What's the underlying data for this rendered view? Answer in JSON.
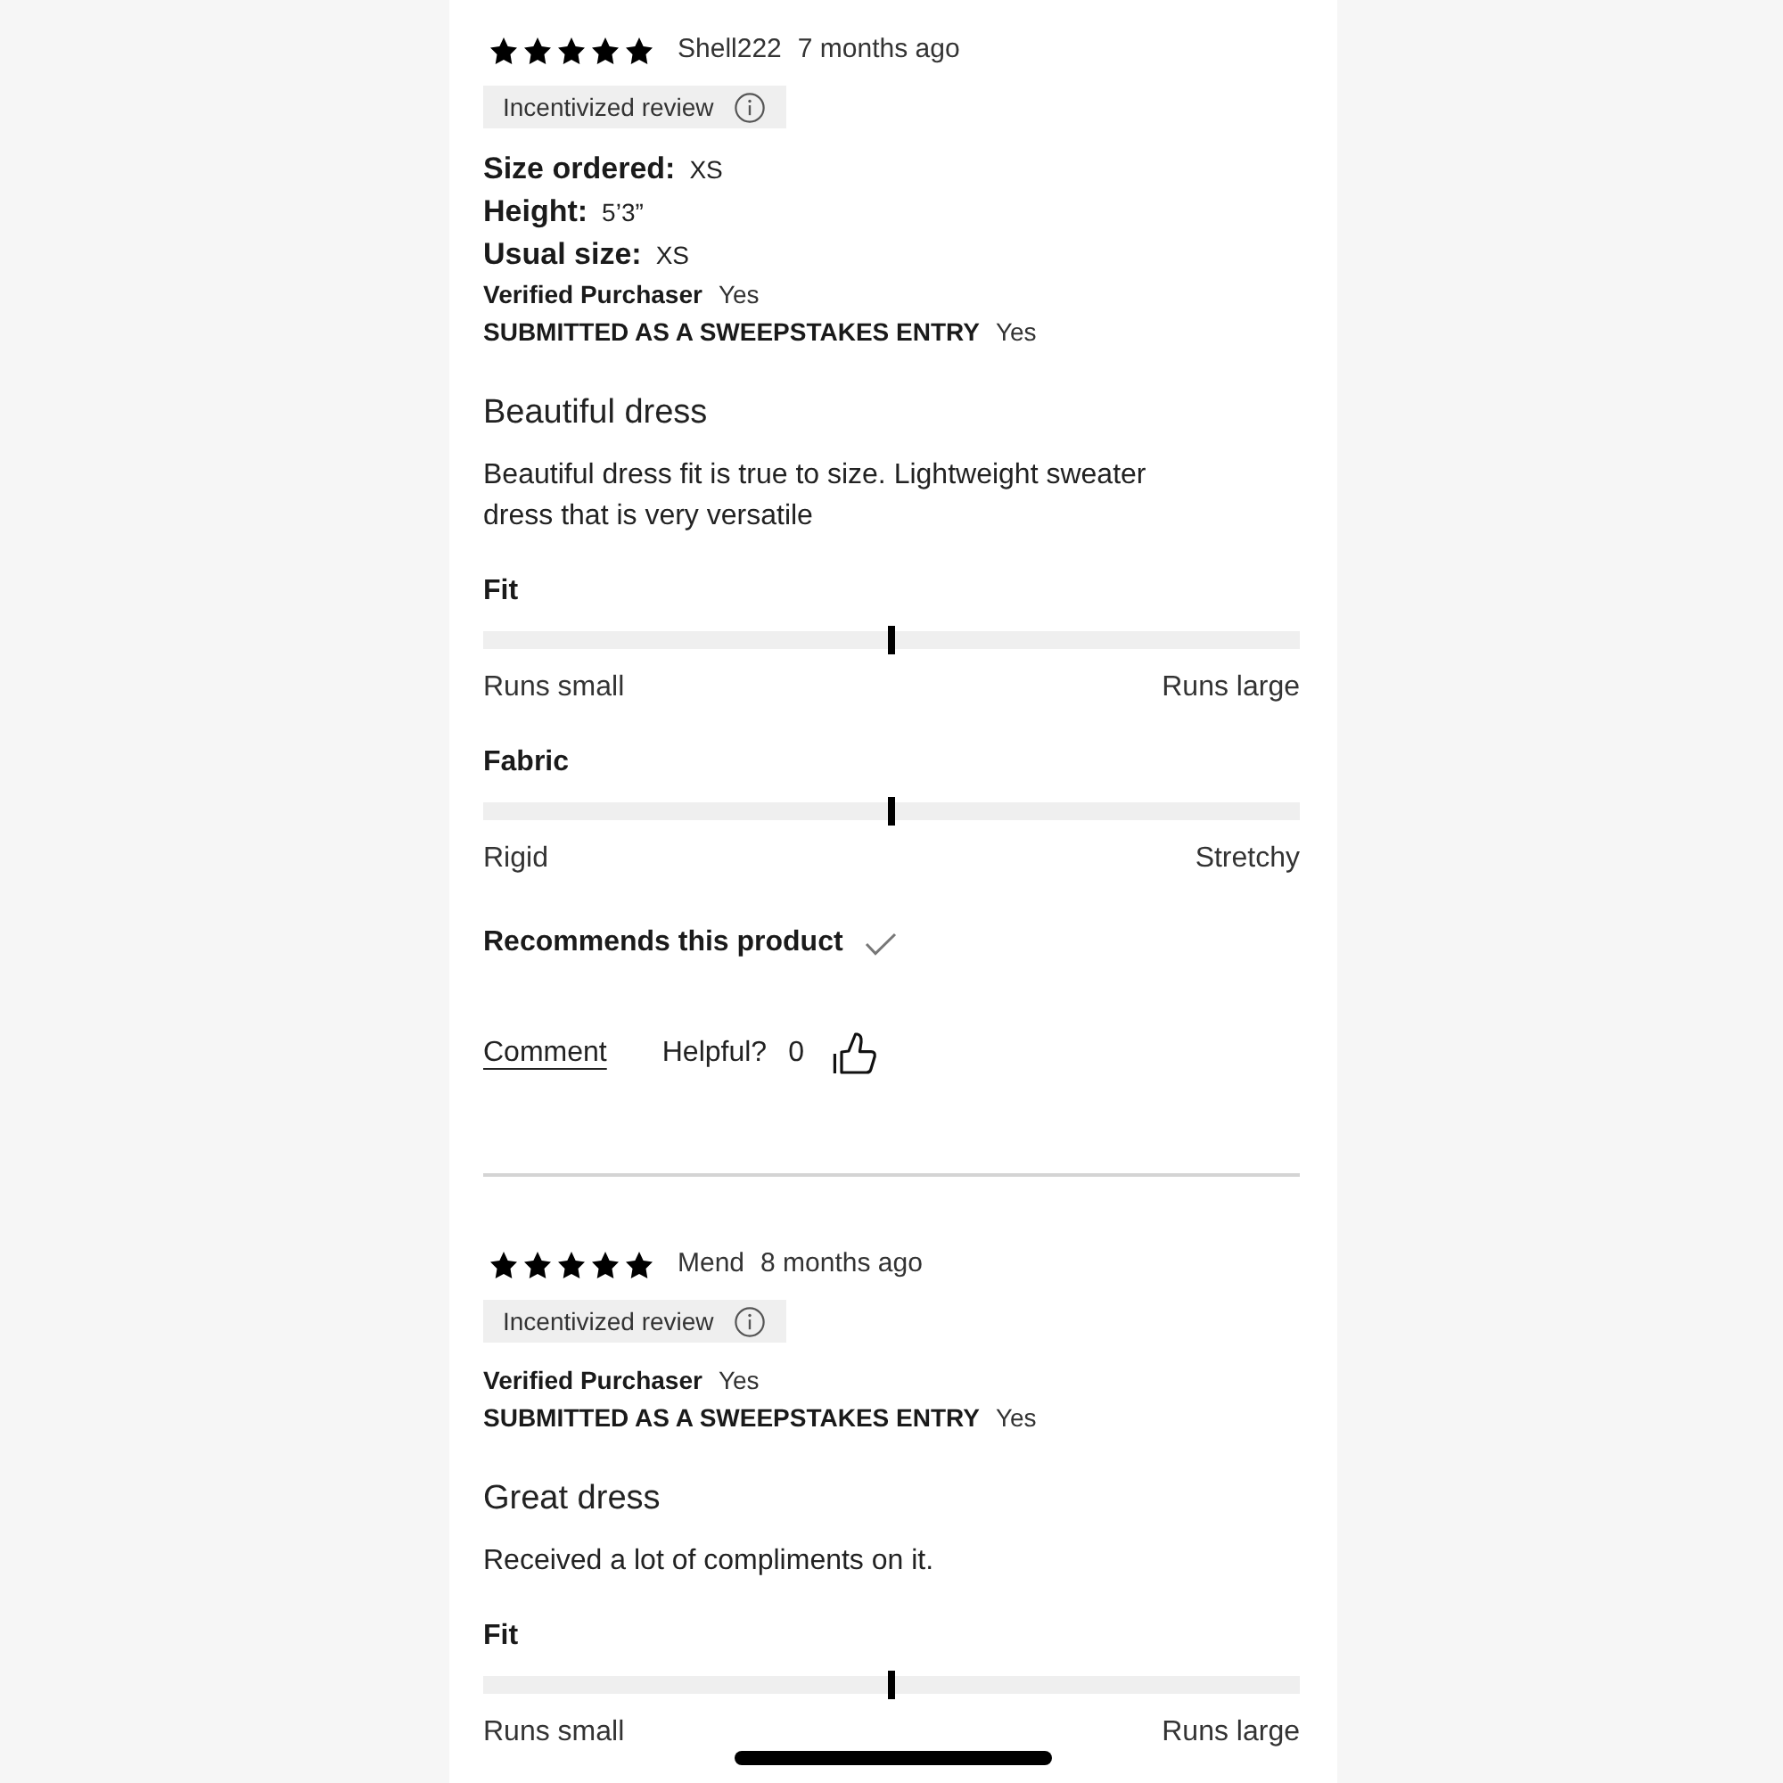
{
  "reviews": [
    {
      "stars": 5,
      "author": "Shell222",
      "date": "7 months ago",
      "tag": "Incentivized review",
      "details": [
        {
          "kind": "measure",
          "label": "Size ordered:",
          "value": "XS"
        },
        {
          "kind": "measure",
          "label": "Height:",
          "value": "5’3”"
        },
        {
          "kind": "measure",
          "label": "Usual size:",
          "value": "XS"
        },
        {
          "kind": "flag",
          "label": "Verified Purchaser",
          "value": "Yes"
        },
        {
          "kind": "flag",
          "label": "SUBMITTED AS A SWEEPSTAKES ENTRY",
          "value": "Yes"
        }
      ],
      "title": "Beautiful dress",
      "body": "Beautiful dress fit is true to size. Lightweight sweater dress that is very versatile",
      "ratings": [
        {
          "label": "Fit",
          "level": 0.5,
          "min_label": "Runs small",
          "max_label": "Runs large"
        },
        {
          "label": "Fabric",
          "level": 0.5,
          "min_label": "Rigid",
          "max_label": "Stretchy"
        }
      ],
      "recommends": {
        "label": "Recommends this product",
        "checked": true
      },
      "comment_link": "Comment",
      "helpful_label": "Helpful?",
      "helpful_count": "0"
    },
    {
      "stars": 5,
      "author": "Mend",
      "date": "8 months ago",
      "tag": "Incentivized review",
      "details": [
        {
          "kind": "flag",
          "label": "Verified Purchaser",
          "value": "Yes"
        },
        {
          "kind": "flag",
          "label": "SUBMITTED AS A SWEEPSTAKES ENTRY",
          "value": "Yes"
        }
      ],
      "title": "Great dress",
      "body": "Received a lot of compliments on it.",
      "ratings": [
        {
          "label": "Fit",
          "level": 0.5,
          "min_label": "Runs small",
          "max_label": "Runs large"
        }
      ]
    }
  ]
}
